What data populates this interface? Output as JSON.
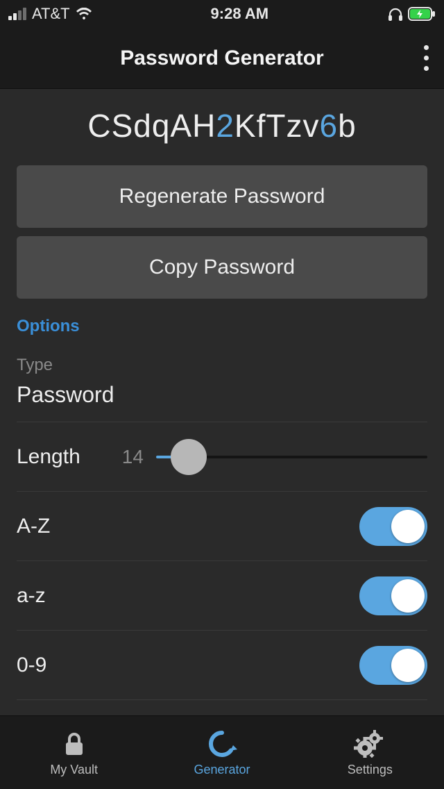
{
  "status": {
    "carrier": "AT&T",
    "time": "9:28 AM"
  },
  "header": {
    "title": "Password Generator"
  },
  "password": {
    "segments": [
      {
        "text": "CSdqAH",
        "kind": "a"
      },
      {
        "text": "2",
        "kind": "n"
      },
      {
        "text": "KfTzv",
        "kind": "a"
      },
      {
        "text": "6",
        "kind": "n"
      },
      {
        "text": "b",
        "kind": "a"
      }
    ]
  },
  "buttons": {
    "regenerate": "Regenerate Password",
    "copy": "Copy Password"
  },
  "options_label": "Options",
  "type": {
    "label": "Type",
    "value": "Password"
  },
  "length": {
    "label": "Length",
    "value": "14"
  },
  "toggles": [
    {
      "label": "A-Z",
      "on": true
    },
    {
      "label": "a-z",
      "on": true
    },
    {
      "label": "0-9",
      "on": true
    }
  ],
  "tabs": [
    {
      "label": "My Vault",
      "icon": "lock",
      "active": false
    },
    {
      "label": "Generator",
      "icon": "refresh",
      "active": true
    },
    {
      "label": "Settings",
      "icon": "gears",
      "active": false
    }
  ]
}
